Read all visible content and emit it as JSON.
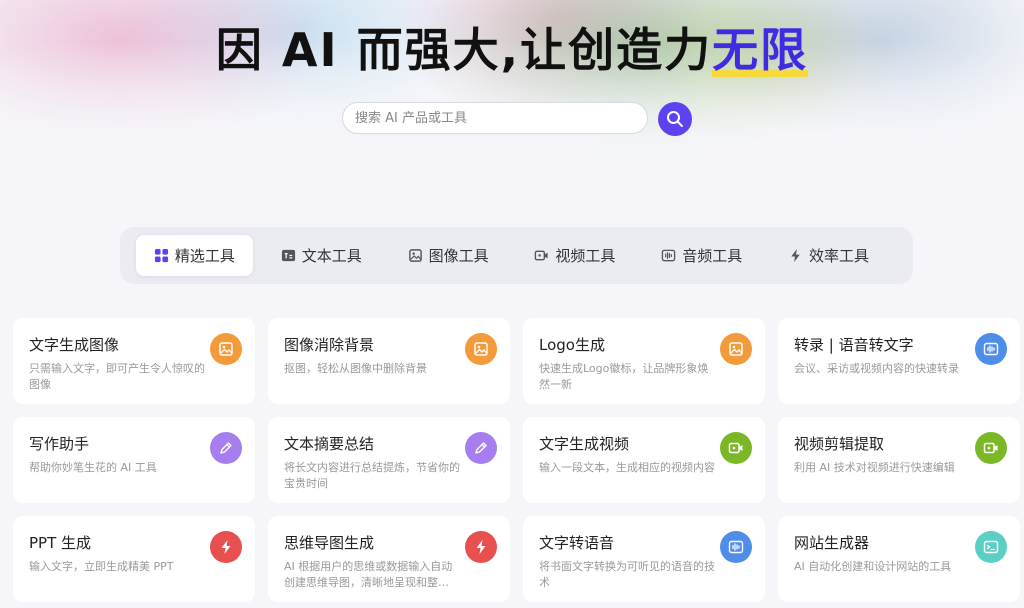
{
  "hero": {
    "title_main": "因 AI 而强大,让创造力",
    "title_accent": "无限"
  },
  "search": {
    "placeholder": "搜索 AI 产品或工具"
  },
  "tabs": [
    {
      "label": "精选工具",
      "icon": "grid-icon",
      "active": true
    },
    {
      "label": "文本工具",
      "icon": "text-icon",
      "active": false
    },
    {
      "label": "图像工具",
      "icon": "image-icon",
      "active": false
    },
    {
      "label": "视频工具",
      "icon": "video-icon",
      "active": false
    },
    {
      "label": "音频工具",
      "icon": "audio-icon",
      "active": false
    },
    {
      "label": "效率工具",
      "icon": "bolt-icon",
      "active": false
    }
  ],
  "colors": {
    "accent": "#3f2be0",
    "search_button": "#5b43f0",
    "orange": "#f39a3b",
    "blue": "#4f8ee8",
    "purple": "#a77ef0",
    "green": "#7bb826",
    "red": "#e8504f",
    "teal": "#5ccfc4"
  },
  "cards": [
    {
      "title": "文字生成图像",
      "desc": "只需输入文字，即可产生令人惊叹的图像",
      "icon": "image-icon",
      "color": "#f39a3b"
    },
    {
      "title": "图像消除背景",
      "desc": "抠图，轻松从图像中删除背景",
      "icon": "image-icon",
      "color": "#f39a3b"
    },
    {
      "title": "Logo生成",
      "desc": "快速生成Logo徽标，让品牌形象焕然一新",
      "icon": "image-icon",
      "color": "#f39a3b"
    },
    {
      "title": "转录 | 语音转文字",
      "desc": "会议、采访或视频内容的快速转录",
      "icon": "audio-icon",
      "color": "#4f8ee8"
    },
    {
      "title": "写作助手",
      "desc": "帮助你妙笔生花的 AI 工具",
      "icon": "pencil-icon",
      "color": "#a77ef0"
    },
    {
      "title": "文本摘要总结",
      "desc": "将长文内容进行总结提炼，节省你的宝贵时间",
      "icon": "pencil-icon",
      "color": "#a77ef0"
    },
    {
      "title": "文字生成视频",
      "desc": "输入一段文本，生成相应的视频内容",
      "icon": "video-icon",
      "color": "#7bb826"
    },
    {
      "title": "视频剪辑提取",
      "desc": "利用 AI 技术对视频进行快速编辑",
      "icon": "video-icon",
      "color": "#7bb826"
    },
    {
      "title": "PPT 生成",
      "desc": "输入文字，立即生成精美 PPT",
      "icon": "bolt-icon",
      "color": "#e8504f"
    },
    {
      "title": "思维导图生成",
      "desc": "AI 根据用户的思维或数据输入自动创建思维导图，清晰地呈现和整…",
      "icon": "bolt-icon",
      "color": "#e8504f"
    },
    {
      "title": "文字转语音",
      "desc": "将书面文字转换为可听见的语音的技术",
      "icon": "audio-icon",
      "color": "#4f8ee8"
    },
    {
      "title": "网站生成器",
      "desc": "AI 自动化创建和设计网站的工具",
      "icon": "terminal-icon",
      "color": "#5ccfc4"
    }
  ]
}
